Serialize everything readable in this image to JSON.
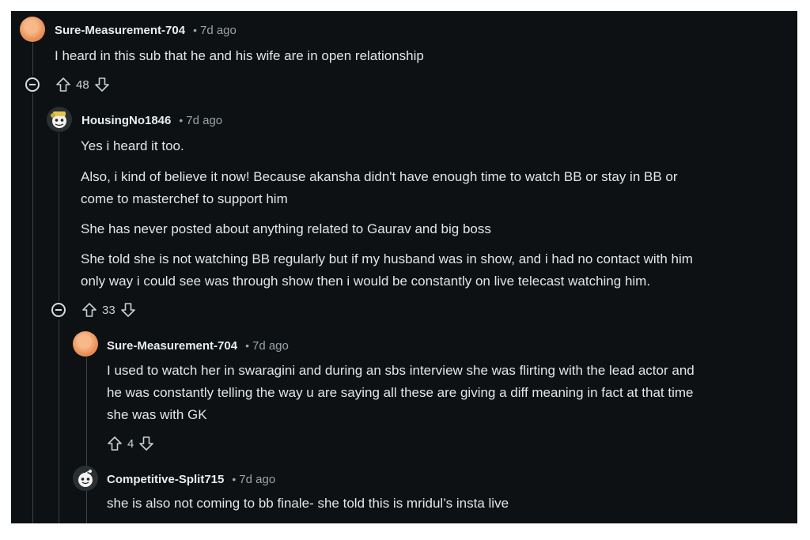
{
  "comments": [
    {
      "username": "Sure-Measurement-704",
      "dot": "•",
      "time": "7d ago",
      "lines": [
        "I heard in this sub that he and his wife are in open relationship"
      ],
      "score": "48"
    },
    {
      "username": "HousingNo1846",
      "dot": "•",
      "time": "7d ago",
      "lines": [
        "Yes i heard it too.",
        "Also, i kind of believe it now! Because akansha didn't have enough time to watch BB or stay in BB or",
        "come to masterchef to support him",
        "She has never posted about anything related to Gaurav and big boss",
        "She told she is not watching BB regularly but if my husband was in show, and i had no contact with him",
        "only way i could see was through show then i would be constantly on live telecast watching him."
      ],
      "score": "33"
    },
    {
      "username": "Sure-Measurement-704",
      "dot": "•",
      "time": "7d ago",
      "lines": [
        "I used to watch her in swaragini and during an sbs interview she was flirting with the lead actor and",
        "he was constantly telling the way u are saying all these are giving a diff meaning in fact at that time",
        "she was with GK"
      ],
      "score": "4"
    },
    {
      "username": "Competitive-Split715",
      "dot": "•",
      "time": "7d ago",
      "lines": [
        "she is also not coming to bb finale- she told this is mridul’s insta live"
      ]
    }
  ],
  "icons": {
    "upvote": "upvote-icon",
    "downvote": "downvote-icon",
    "collapse": "collapse-thread-icon"
  },
  "colors": {
    "background": "#0e1113",
    "text": "#e2e6e8",
    "meta": "#9aa3a7",
    "avatar_orange": "#e9925a"
  }
}
